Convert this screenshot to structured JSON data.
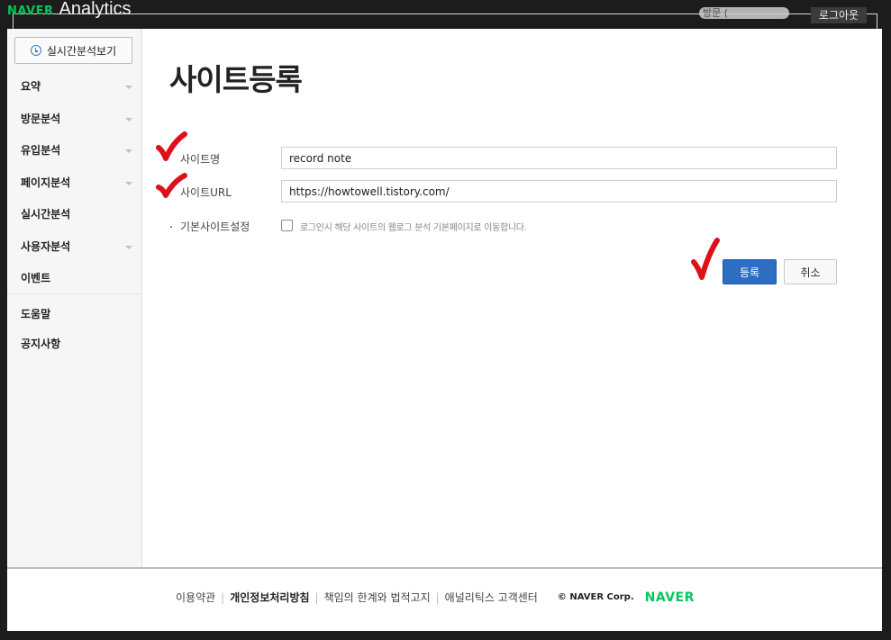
{
  "header": {
    "brand_naver": "NAVER",
    "brand_product": "Analytics",
    "user_info": "방문 (",
    "logout_label": "로그아웃"
  },
  "sidebar": {
    "realtime_button": "실시간분석보기",
    "items": [
      {
        "label": "요약",
        "has_submenu": true
      },
      {
        "label": "방문분석",
        "has_submenu": true
      },
      {
        "label": "유입분석",
        "has_submenu": true
      },
      {
        "label": "페이지분석",
        "has_submenu": true
      },
      {
        "label": "실시간분석",
        "has_submenu": false
      },
      {
        "label": "사용자분석",
        "has_submenu": true
      },
      {
        "label": "이벤트",
        "has_submenu": false
      }
    ],
    "help_items": [
      {
        "label": "도움말"
      },
      {
        "label": "공지사항"
      }
    ]
  },
  "main": {
    "title": "사이트등록",
    "form": {
      "site_name_label": "사이트명",
      "site_name_value": "record note",
      "site_url_label": "사이트URL",
      "site_url_value": "https://howtowell.tistory.com/",
      "default_site_label": "기본사이트설정",
      "default_site_checked": false,
      "default_site_desc": "로그인시 해당 사이트의 웹로그 분석 기본페이지로 이동합니다."
    },
    "buttons": {
      "register": "등록",
      "cancel": "취소"
    }
  },
  "footer": {
    "links": [
      {
        "label": "이용약관",
        "bold": false
      },
      {
        "label": "개인정보처리방침",
        "bold": true
      },
      {
        "label": "책임의 한계와 법적고지",
        "bold": false
      },
      {
        "label": "애널리틱스 고객센터",
        "bold": false
      }
    ],
    "copyright": "© NAVER Corp.",
    "logo": "NAVER"
  },
  "colors": {
    "accent_blue": "#2d6ec2",
    "naver_green": "#03c75a",
    "annotation_red": "#e0101a"
  }
}
